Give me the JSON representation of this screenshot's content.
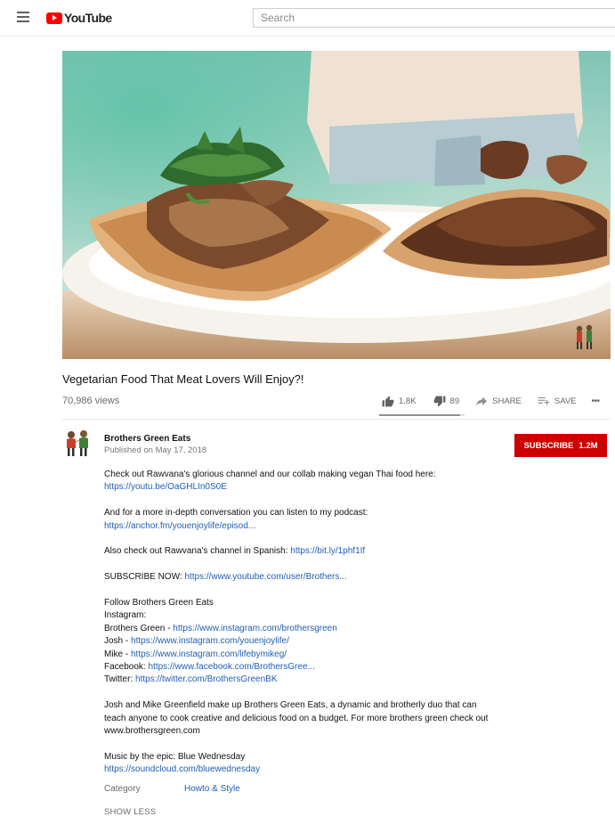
{
  "header": {
    "logo_text": "YouTube",
    "search_placeholder": "Search"
  },
  "video": {
    "title": "Vegetarian Food That Meat Lovers Will Enjoy?!",
    "views": "70,986 views",
    "likes": "1.8K",
    "dislikes": "89",
    "like_ratio": 0.953,
    "share_label": "SHARE",
    "save_label": "SAVE",
    "more_label": "•••"
  },
  "channel": {
    "name": "Brothers Green Eats",
    "published": "Published on May 17, 2018",
    "subscribe_label": "SUBSCRIBE",
    "subscriber_count": "1.2M"
  },
  "description": {
    "line1": "Check out Rawvana's glorious channel and our collab making vegan Thai food here:",
    "link1": "https://youtu.be/OaGHLIn0S0E",
    "line2": "And for a more in-depth conversation you can listen to my podcast:",
    "link2": "https://anchor.fm/youenjoylife/episod...",
    "line3_prefix": "Also check out Rawvana's channel in Spanish: ",
    "link3": "https://bit.ly/1phf1If",
    "line4_prefix": "SUBSCRIBE NOW: ",
    "link4": "https://www.youtube.com/user/Brothers...",
    "follow_heading": "Follow Brothers Green Eats",
    "instagram_label": "Instagram:",
    "bg_prefix": "Brothers Green - ",
    "bg_link": "https://www.instagram.com/brothersgreen",
    "josh_prefix": "Josh - ",
    "josh_link": "https://www.instagram.com/youenjoylife/",
    "mike_prefix": "Mike - ",
    "mike_link": "https://www.instagram.com/lifebymikeg/",
    "facebook_prefix": "Facebook: ",
    "facebook_link": "https://www.facebook.com/BrothersGree...",
    "twitter_prefix": "Twitter: ",
    "twitter_link": "https://twitter.com/BrothersGreenBK",
    "about_line1": "Josh and Mike Greenfield make up Brothers Green Eats, a dynamic and brotherly duo that can",
    "about_line2": "teach anyone to cook creative and delicious food on a budget. For more brothers green check out",
    "about_line3": "www.brothersgreen.com",
    "music_line": "Music by the epic: Blue Wednesday",
    "music_link": "https://soundcloud.com/bluewednesday"
  },
  "meta": {
    "category_label": "Category",
    "category_value": "Howto & Style",
    "show_less": "SHOW LESS"
  },
  "colors": {
    "brand_red": "#ff0000",
    "subscribe_red": "#cc0000",
    "link_blue": "#1f5fb4"
  }
}
